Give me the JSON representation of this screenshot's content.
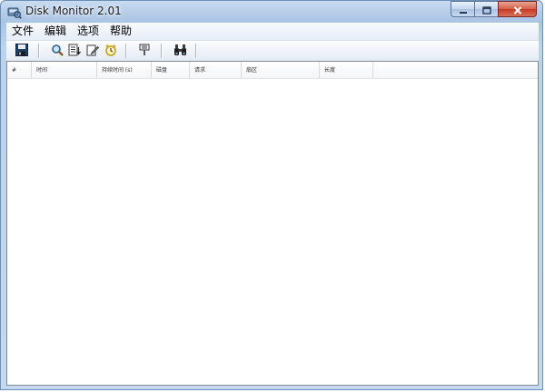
{
  "window": {
    "title": "Disk Monitor 2.01",
    "icons": {
      "app": "disk-monitor-icon",
      "minimize": "minimize-icon",
      "maximize": "maximize-icon",
      "close": "close-icon"
    }
  },
  "menu": {
    "items": [
      "文件",
      "编辑",
      "选项",
      "帮助"
    ]
  },
  "toolbar": {
    "buttons": [
      "save-icon",
      "magnifier-icon",
      "capture-icon",
      "edit-icon",
      "clock-icon",
      "filter-icon",
      "binoculars-icon"
    ]
  },
  "list": {
    "columns": [
      "#",
      "时间",
      "持续时间 (s)",
      "磁盘",
      "请求",
      "扇区",
      "长度"
    ],
    "rows": []
  },
  "colors": {
    "titlebar": "#b6cde9",
    "close_button": "#c43a22",
    "list_background": "#ffffff"
  }
}
